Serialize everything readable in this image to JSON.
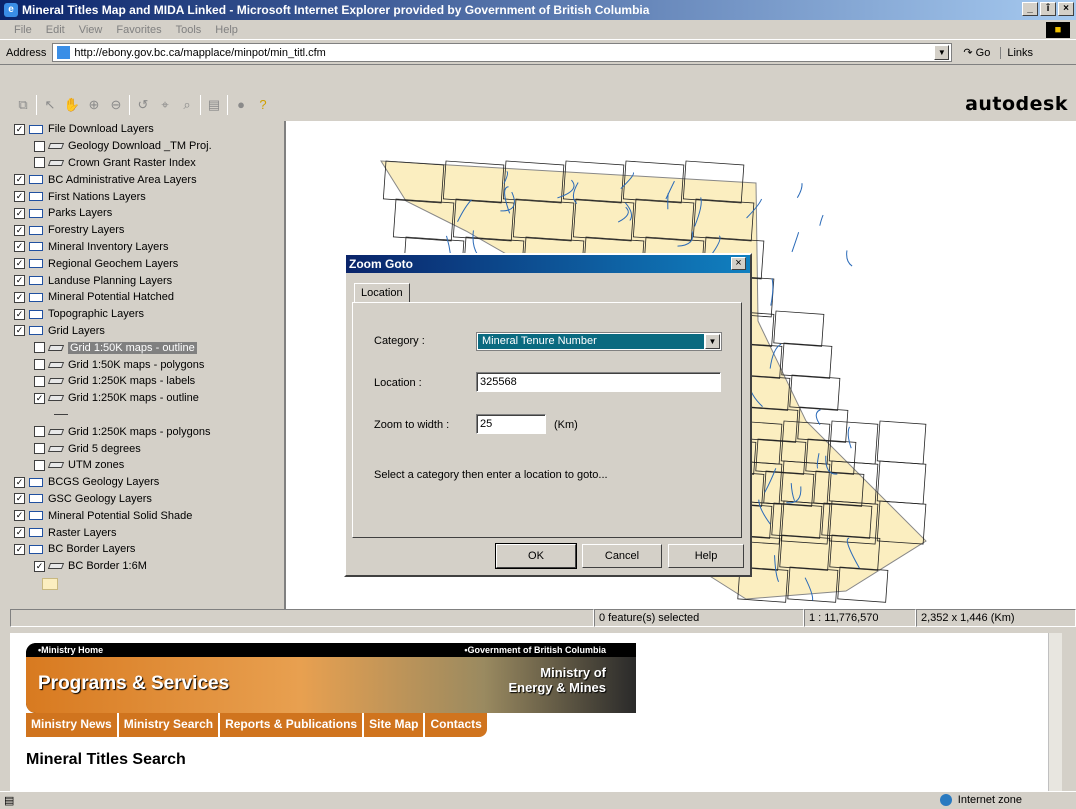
{
  "window": {
    "title": "Mineral Titles Map and MIDA Linked - Microsoft Internet Explorer provided by Government of British Columbia",
    "min": "_",
    "max": "î",
    "close": "×"
  },
  "menu": [
    "File",
    "Edit",
    "View",
    "Favorites",
    "Tools",
    "Help"
  ],
  "address": {
    "label": "Address",
    "url": "http://ebony.gov.bc.ca/mapplace/minpot/min_titl.cfm",
    "go": "Go",
    "links": "Links"
  },
  "brand": "autodesk",
  "layers": [
    {
      "label": "File Download Layers",
      "checked": true,
      "level": 0
    },
    {
      "label": "Geology Download _TM Proj.",
      "checked": false,
      "level": 1
    },
    {
      "label": "Crown Grant Raster Index",
      "checked": false,
      "level": 1
    },
    {
      "label": "BC Administrative Area Layers",
      "checked": true,
      "level": 0
    },
    {
      "label": "First Nations Layers",
      "checked": true,
      "level": 0
    },
    {
      "label": "Parks Layers",
      "checked": true,
      "level": 0
    },
    {
      "label": "Forestry Layers",
      "checked": true,
      "level": 0
    },
    {
      "label": "Mineral Inventory Layers",
      "checked": true,
      "level": 0
    },
    {
      "label": "Regional Geochem Layers",
      "checked": true,
      "level": 0
    },
    {
      "label": "Landuse Planning Layers",
      "checked": true,
      "level": 0
    },
    {
      "label": "Mineral Potential Hatched",
      "checked": true,
      "level": 0
    },
    {
      "label": "Topographic Layers",
      "checked": true,
      "level": 0
    },
    {
      "label": "Grid Layers",
      "checked": true,
      "level": 0
    },
    {
      "label": "Grid 1:50K maps - outline",
      "checked": false,
      "level": 1,
      "selected": true
    },
    {
      "label": "Grid 1:50K maps - polygons",
      "checked": false,
      "level": 1
    },
    {
      "label": "Grid 1:250K maps - labels",
      "checked": false,
      "level": 1
    },
    {
      "label": "Grid 1:250K maps - outline",
      "checked": true,
      "level": 1
    },
    {
      "label": "",
      "checked": null,
      "level": 2
    },
    {
      "label": "Grid 1:250K maps - polygons",
      "checked": false,
      "level": 1
    },
    {
      "label": "Grid 5 degrees",
      "checked": false,
      "level": 1
    },
    {
      "label": "UTM zones",
      "checked": false,
      "level": 1
    },
    {
      "label": "BCGS Geology Layers",
      "checked": true,
      "level": 0
    },
    {
      "label": "GSC Geology Layers",
      "checked": true,
      "level": 0
    },
    {
      "label": "Mineral Potential Solid Shade",
      "checked": true,
      "level": 0
    },
    {
      "label": "Raster Layers",
      "checked": true,
      "level": 0
    },
    {
      "label": "BC Border Layers",
      "checked": true,
      "level": 0
    },
    {
      "label": "BC Border 1:6M",
      "checked": true,
      "level": 1
    }
  ],
  "status": {
    "selected": "0 feature(s) selected",
    "scale": "1 : 11,776,570",
    "extent": "2,352 x 1,446 (Km)"
  },
  "dialog": {
    "title": "Zoom Goto",
    "close": "×",
    "tab": "Location",
    "category_label": "Category :",
    "category_value": "Mineral Tenure Number",
    "location_label": "Location :",
    "location_value": "325568",
    "zoom_label": "Zoom to width :",
    "zoom_value": "25",
    "zoom_unit": "(Km)",
    "hint": "Select a category then enter a location to goto...",
    "ok": "OK",
    "cancel": "Cancel",
    "help": "Help"
  },
  "web": {
    "ministry_home": "•Ministry Home",
    "gov_bc": "•Government of British Columbia",
    "programs": "Programs & Services",
    "ministry_line1": "Ministry of",
    "ministry_line2": "Energy & Mines",
    "nav": [
      "Ministry News",
      "Ministry Search",
      "Reports & Publications",
      "Site Map",
      "Contacts"
    ],
    "page_title": "Mineral Titles Search"
  },
  "statusbar": {
    "zone": "Internet zone"
  },
  "colors": {
    "titlebar": "#0a246a",
    "map_land": "#fbeec0",
    "rivers": "#2a6ab8",
    "orange": "#d0741e"
  }
}
